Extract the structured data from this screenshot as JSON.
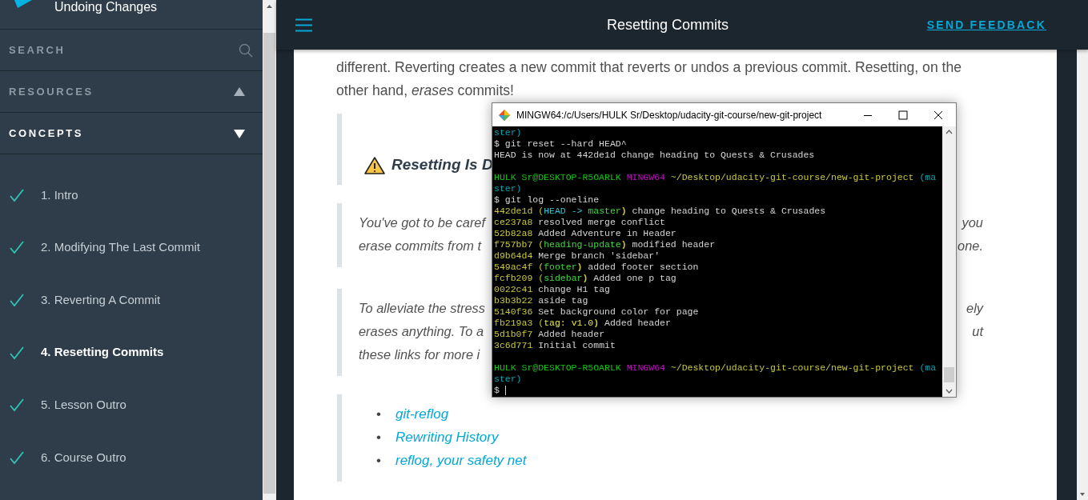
{
  "sidebar": {
    "lesson_title": "Undoing Changes",
    "search": {
      "label": "SEARCH"
    },
    "sections": [
      {
        "label": "RESOURCES",
        "expanded": false
      },
      {
        "label": "CONCEPTS",
        "expanded": true
      }
    ],
    "concepts": [
      {
        "label": "1. Intro",
        "completed": true,
        "selected": false
      },
      {
        "label": "2. Modifying The Last Commit",
        "completed": true,
        "selected": false
      },
      {
        "label": "3. Reverting A Commit",
        "completed": true,
        "selected": false
      },
      {
        "label": "4. Resetting Commits",
        "completed": true,
        "selected": true
      },
      {
        "label": "5. Lesson Outro",
        "completed": true,
        "selected": false
      },
      {
        "label": "6. Course Outro",
        "completed": true,
        "selected": false
      }
    ]
  },
  "header": {
    "title": "Resetting Commits",
    "feedback": "SEND FEEDBACK"
  },
  "content": {
    "intro": "different. Reverting creates a new commit that reverts or undos a previous commit. Resetting, on the other hand, *erases* commits!",
    "callout_heading": "Resetting Is D",
    "paragraphs": [
      {
        "lines": [
          {
            "left": "You've got to be caref",
            "right": "you"
          },
          {
            "left": "erase commits from t",
            "right": "one."
          }
        ]
      },
      {
        "lines": [
          {
            "left": "To alleviate the stress",
            "right": "ely"
          },
          {
            "left": "erases anything. To a",
            "right": "ut"
          },
          {
            "left": "these links for more i"
          }
        ]
      }
    ],
    "links": [
      {
        "bullet": "•",
        "label": "git-reflog"
      },
      {
        "bullet": "•",
        "label": "Rewriting History"
      },
      {
        "bullet": "•",
        "label": "reflog, your safety net"
      }
    ]
  },
  "terminal": {
    "title": "MINGW64:/c/Users/HULK Sr/Desktop/udacity-git-course/new-git-project",
    "lines": [
      {
        "kind": "text",
        "segments": [
          {
            "text": "ster)",
            "color": "#00a6b2"
          }
        ]
      },
      {
        "kind": "text",
        "segments": [
          {
            "text": "$ git reset --hard HEAD^",
            "color": "#d4d4d4"
          }
        ]
      },
      {
        "kind": "text",
        "segments": [
          {
            "text": "HEAD is now at 442de1d change heading to Quests & Crusades",
            "color": "#d4d4d4"
          }
        ]
      },
      {
        "kind": "blank"
      },
      {
        "kind": "text",
        "segments": [
          {
            "text": "HULK Sr@DESKTOP-R5OARLK ",
            "color": "#13c313"
          },
          {
            "text": "MINGW64 ",
            "color": "#c010c0"
          },
          {
            "text": "~/Desktop/udacity-git-course/new-git-project ",
            "color": "#c8c83a"
          },
          {
            "text": "(ma",
            "color": "#00a6b2"
          }
        ]
      },
      {
        "kind": "text",
        "segments": [
          {
            "text": "ster)",
            "color": "#00a6b2"
          }
        ]
      },
      {
        "kind": "text",
        "segments": [
          {
            "text": "$ git log --oneline",
            "color": "#d4d4d4"
          }
        ]
      },
      {
        "kind": "text",
        "segments": [
          {
            "text": "442de1d (",
            "color": "#c8c83a"
          },
          {
            "text": "HEAD -> ",
            "color": "#2ec4d0"
          },
          {
            "text": "master",
            "color": "#3ed83e"
          },
          {
            "text": ")",
            "color": "#c8c83a"
          },
          {
            "text": " change heading to Quests & Crusades",
            "color": "#d4d4d4"
          }
        ]
      },
      {
        "kind": "text",
        "segments": [
          {
            "text": "ce237a8",
            "color": "#c8c83a"
          },
          {
            "text": " resolved merge conflict",
            "color": "#d4d4d4"
          }
        ]
      },
      {
        "kind": "text",
        "segments": [
          {
            "text": "52b82a8",
            "color": "#c8c83a"
          },
          {
            "text": " Added Adventure in Header",
            "color": "#d4d4d4"
          }
        ]
      },
      {
        "kind": "text",
        "segments": [
          {
            "text": "f757bb7 (",
            "color": "#c8c83a"
          },
          {
            "text": "heading-update",
            "color": "#3ed83e"
          },
          {
            "text": ")",
            "color": "#c8c83a"
          },
          {
            "text": " modified header",
            "color": "#d4d4d4"
          }
        ]
      },
      {
        "kind": "text",
        "segments": [
          {
            "text": "d9b64d4",
            "color": "#c8c83a"
          },
          {
            "text": " Merge branch 'sidebar'",
            "color": "#d4d4d4"
          }
        ]
      },
      {
        "kind": "text",
        "segments": [
          {
            "text": "549ac4f (",
            "color": "#c8c83a"
          },
          {
            "text": "footer",
            "color": "#3ed83e"
          },
          {
            "text": ")",
            "color": "#c8c83a"
          },
          {
            "text": " added footer section",
            "color": "#d4d4d4"
          }
        ]
      },
      {
        "kind": "text",
        "segments": [
          {
            "text": "fcfb209 (",
            "color": "#c8c83a"
          },
          {
            "text": "sidebar",
            "color": "#3ed83e"
          },
          {
            "text": ")",
            "color": "#c8c83a"
          },
          {
            "text": " Added one p tag",
            "color": "#d4d4d4"
          }
        ]
      },
      {
        "kind": "text",
        "segments": [
          {
            "text": "0022c41",
            "color": "#c8c83a"
          },
          {
            "text": " change H1 tag",
            "color": "#d4d4d4"
          }
        ]
      },
      {
        "kind": "text",
        "segments": [
          {
            "text": "b3b3b22",
            "color": "#c8c83a"
          },
          {
            "text": " aside tag",
            "color": "#d4d4d4"
          }
        ]
      },
      {
        "kind": "text",
        "segments": [
          {
            "text": "5140f36",
            "color": "#c8c83a"
          },
          {
            "text": " Set background color for page",
            "color": "#d4d4d4"
          }
        ]
      },
      {
        "kind": "text",
        "segments": [
          {
            "text": "fb219a3 (",
            "color": "#c8c83a"
          },
          {
            "text": "tag: v1.0",
            "color": "#e8e84a"
          },
          {
            "text": ")",
            "color": "#c8c83a"
          },
          {
            "text": " Added header",
            "color": "#d4d4d4"
          }
        ]
      },
      {
        "kind": "text",
        "segments": [
          {
            "text": "5d1b0f7",
            "color": "#c8c83a"
          },
          {
            "text": " Added header",
            "color": "#d4d4d4"
          }
        ]
      },
      {
        "kind": "text",
        "segments": [
          {
            "text": "3c6d771",
            "color": "#c8c83a"
          },
          {
            "text": " Initial commit",
            "color": "#d4d4d4"
          }
        ]
      },
      {
        "kind": "blank"
      },
      {
        "kind": "text",
        "segments": [
          {
            "text": "HULK Sr@DESKTOP-R5OARLK ",
            "color": "#13c313"
          },
          {
            "text": "MINGW64 ",
            "color": "#c010c0"
          },
          {
            "text": "~/Desktop/udacity-git-course/new-git-project ",
            "color": "#c8c83a"
          },
          {
            "text": "(ma",
            "color": "#00a6b2"
          }
        ]
      },
      {
        "kind": "text",
        "segments": [
          {
            "text": "ster)",
            "color": "#00a6b2"
          }
        ]
      },
      {
        "kind": "prompt",
        "segments": [
          {
            "text": "$ ",
            "color": "#d4d4d4"
          }
        ],
        "cursor": true
      }
    ]
  }
}
